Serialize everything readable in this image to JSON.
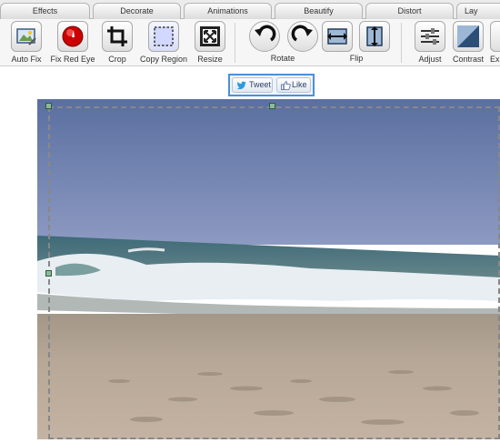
{
  "tabs": [
    "Effects",
    "Decorate",
    "Animations",
    "Beautify",
    "Distort",
    "Lay"
  ],
  "tools": {
    "auto_fix": "Auto Fix",
    "fix_red_eye": "Fix Red Eye",
    "crop": "Crop",
    "copy_region": "Copy Region",
    "resize": "Resize",
    "rotate": "Rotate",
    "flip": "Flip",
    "adjust": "Adjust",
    "contrast": "Contrast",
    "partial": "Ex"
  },
  "social": {
    "tweet": "Tweet",
    "like": "Like"
  },
  "icons": {
    "auto_fix": "magic-picture-icon",
    "red_eye": "red-eye-icon",
    "crop": "crop-icon",
    "copy_region": "dashed-region-icon",
    "resize": "resize-icon",
    "rotate_left": "rotate-left-icon",
    "rotate_right": "rotate-right-icon",
    "flip_h": "flip-horizontal-icon",
    "flip_v": "flip-vertical-icon",
    "adjust": "sliders-icon",
    "contrast": "contrast-icon"
  },
  "colors": {
    "accent": "#4a90d9",
    "red_eye": "#cc0000"
  }
}
